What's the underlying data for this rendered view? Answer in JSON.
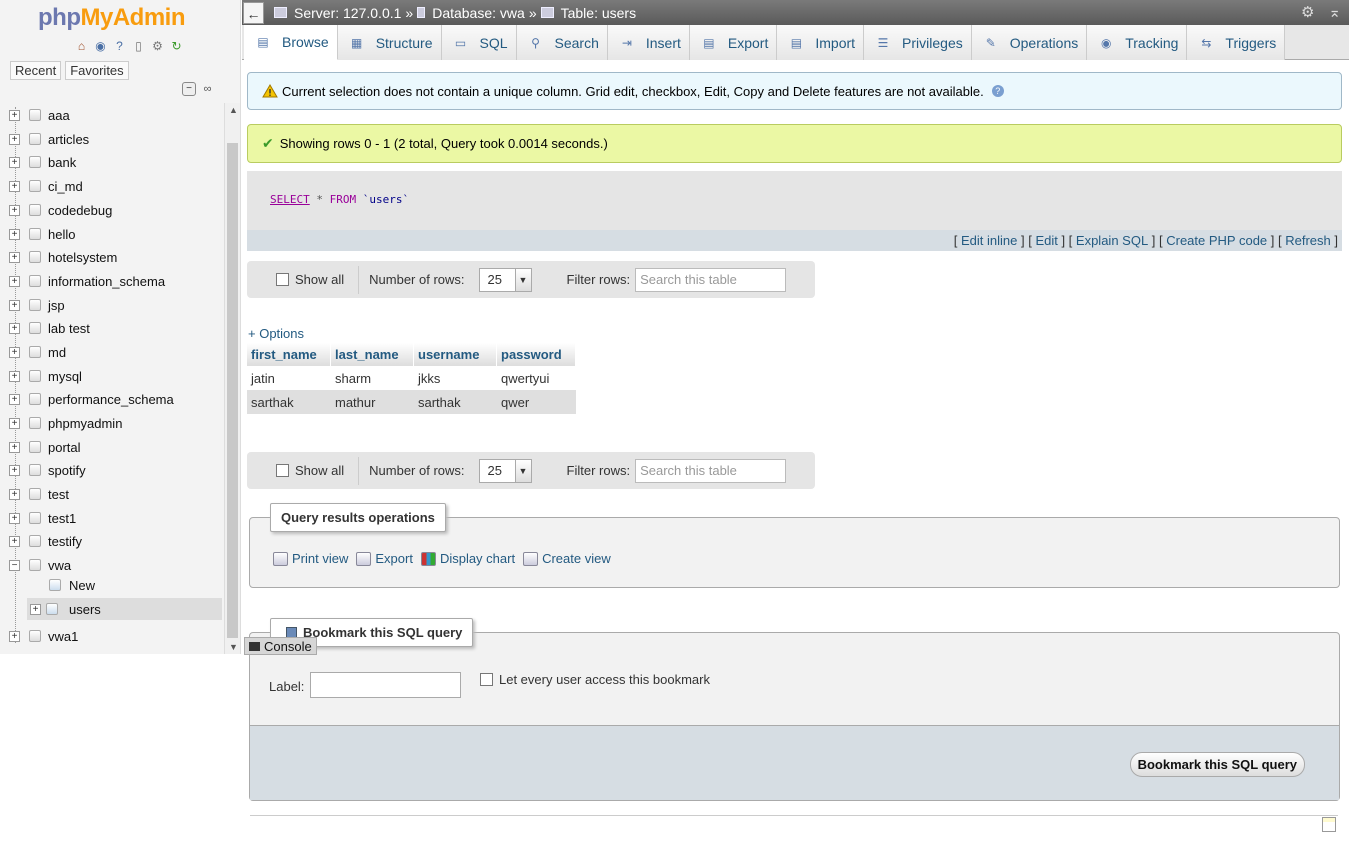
{
  "logo": {
    "php": "php",
    "my": "My",
    "admin": "Admin"
  },
  "nav": {
    "tabs": [
      "Recent",
      "Favorites"
    ],
    "databases": [
      {
        "label": "aaa"
      },
      {
        "label": "articles"
      },
      {
        "label": "bank"
      },
      {
        "label": "ci_md"
      },
      {
        "label": "codedebug"
      },
      {
        "label": "hello"
      },
      {
        "label": "hotelsystem"
      },
      {
        "label": "information_schema"
      },
      {
        "label": "jsp"
      },
      {
        "label": "lab test"
      },
      {
        "label": "md"
      },
      {
        "label": "mysql"
      },
      {
        "label": "performance_schema"
      },
      {
        "label": "phpmyadmin"
      },
      {
        "label": "portal"
      },
      {
        "label": "spotify"
      },
      {
        "label": "test"
      },
      {
        "label": "test1"
      },
      {
        "label": "testify"
      },
      {
        "label": "vwa"
      },
      {
        "label": "New"
      },
      {
        "label": "users"
      },
      {
        "label": "vwa1"
      }
    ]
  },
  "breadcrumb": {
    "server": "Server: 127.0.0.1",
    "sep": "»",
    "database": "Database: vwa",
    "table": "Table: users"
  },
  "tabs": [
    "Browse",
    "Structure",
    "SQL",
    "Search",
    "Insert",
    "Export",
    "Import",
    "Privileges",
    "Operations",
    "Tracking",
    "Triggers"
  ],
  "notice": "Current selection does not contain a unique column. Grid edit, checkbox, Edit, Copy and Delete features are not available.",
  "success": "Showing rows 0 - 1 (2 total, Query took 0.0014 seconds.)",
  "sql": {
    "select": "SELECT",
    "star": "*",
    "from": "FROM",
    "table": "`users`"
  },
  "sql_links": [
    "Edit inline",
    "Edit",
    "Explain SQL",
    "Create PHP code",
    "Refresh"
  ],
  "rows_bar": {
    "show_all": "Show all",
    "number_of_rows_label": "Number of rows:",
    "number_of_rows_value": "25",
    "filter_label": "Filter rows:",
    "filter_placeholder": "Search this table"
  },
  "options_link": "+ Options",
  "table": {
    "columns": [
      "first_name",
      "last_name",
      "username",
      "password"
    ],
    "rows": [
      [
        "jatin",
        "sharm",
        "jkks",
        "qwertyui"
      ],
      [
        "sarthak",
        "mathur",
        "sarthak",
        "qwer"
      ]
    ]
  },
  "query_results_operations": {
    "legend": "Query results operations",
    "links": [
      "Print view",
      "Export",
      "Display chart",
      "Create view"
    ]
  },
  "bookmark": {
    "legend": "Bookmark this SQL query",
    "label": "Label:",
    "everyone": "Let every user access this bookmark",
    "button": "Bookmark this SQL query"
  },
  "console": "Console",
  "colors": {
    "link": "#235a81",
    "notice_bg": "#ebf8fd",
    "success_bg": "#ebf8a4",
    "topbar": "#666666"
  }
}
